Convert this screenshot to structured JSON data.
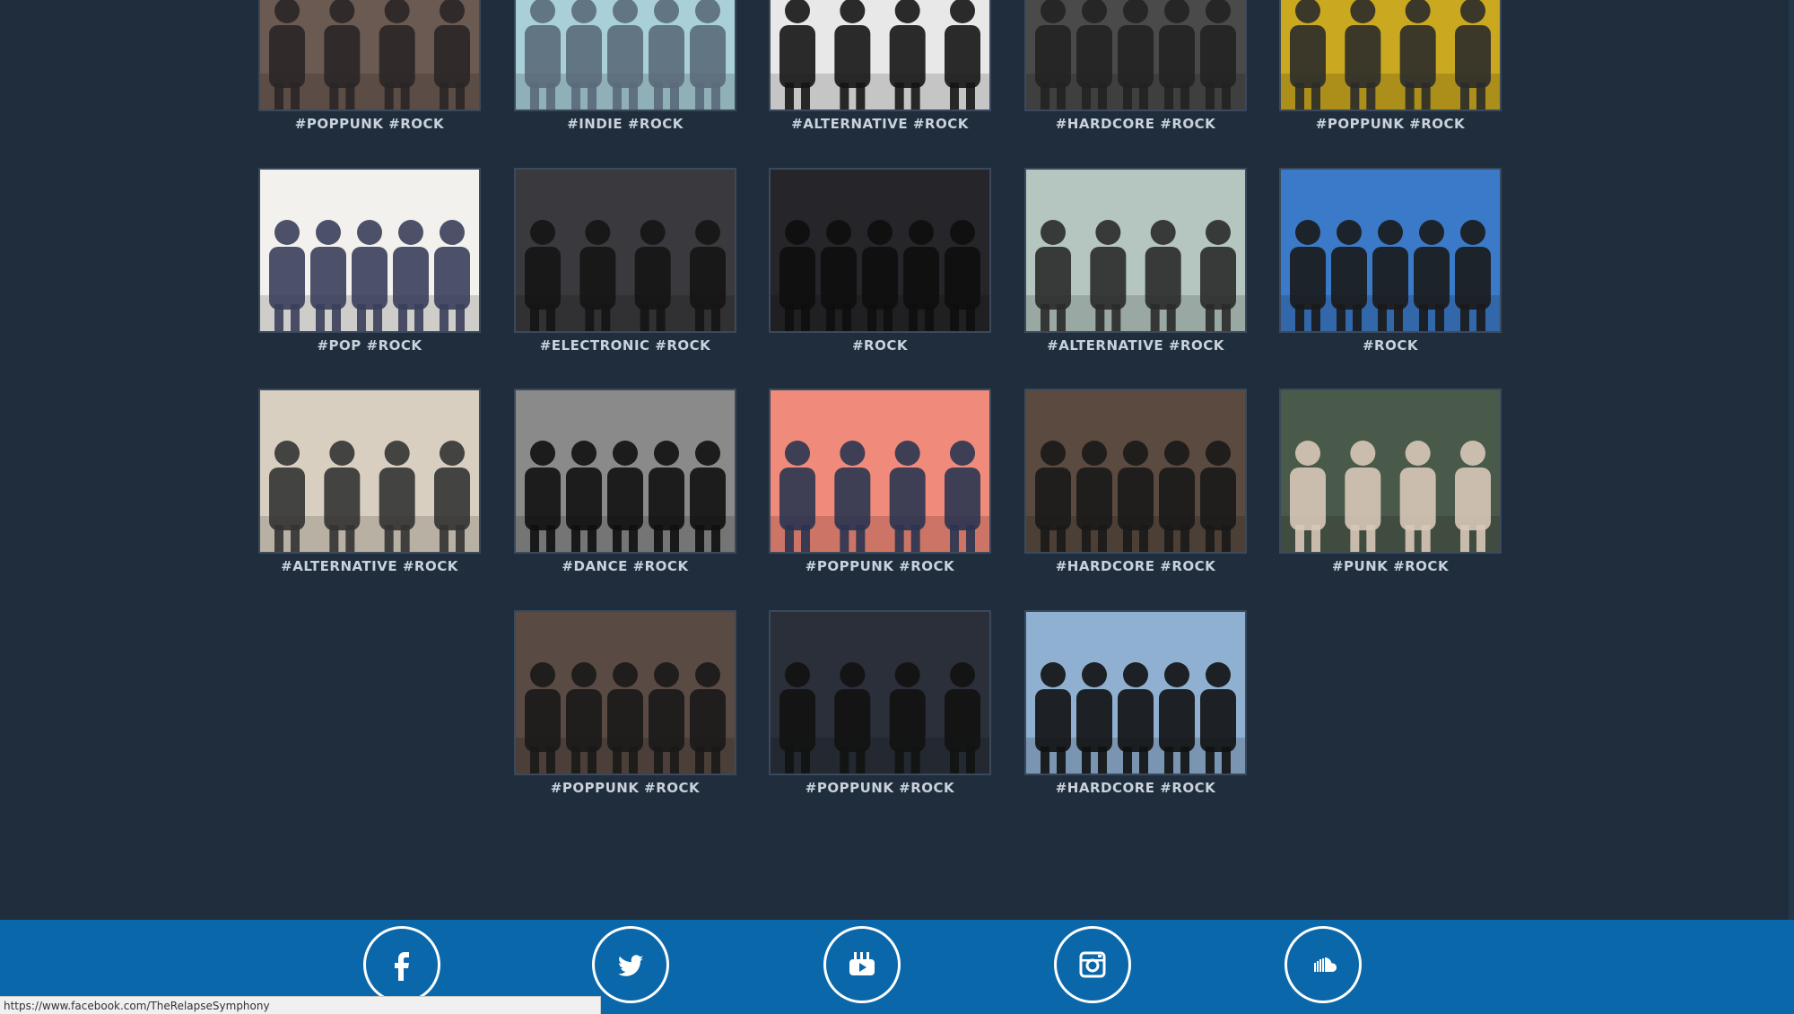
{
  "bands": [
    {
      "tag": "#POPPUNK #ROCK",
      "bg": "#6b5a52",
      "fg": "#2a2626"
    },
    {
      "tag": "#INDIE #ROCK",
      "bg": "#a9cfd8",
      "fg": "#5a6a7a"
    },
    {
      "tag": "#ALTERNATIVE #ROCK",
      "bg": "#e8e8e8",
      "fg": "#151515"
    },
    {
      "tag": "#HARDCORE #ROCK",
      "bg": "#4a4a4a",
      "fg": "#222222"
    },
    {
      "tag": "#POPPUNK #ROCK",
      "bg": "#caa920",
      "fg": "#2b2b2b"
    },
    {
      "tag": "#POP #ROCK",
      "bg": "#f3f1ee",
      "fg": "#3a3f5a"
    },
    {
      "tag": "#ELECTRONIC #ROCK",
      "bg": "#3a3a3e",
      "fg": "#151515"
    },
    {
      "tag": "#ROCK",
      "bg": "#26262a",
      "fg": "#0e0e0e"
    },
    {
      "tag": "#ALTERNATIVE #ROCK",
      "bg": "#b5c6c0",
      "fg": "#2a2a2a"
    },
    {
      "tag": "#ROCK",
      "bg": "#3b7ac8",
      "fg": "#1a1a1a"
    },
    {
      "tag": "#ALTERNATIVE #ROCK",
      "bg": "#d8cfc0",
      "fg": "#333333"
    },
    {
      "tag": "#DANCE #ROCK",
      "bg": "#8a8a8a",
      "fg": "#101010"
    },
    {
      "tag": "#POPPUNK #ROCK",
      "bg": "#f08a7a",
      "fg": "#2a3550"
    },
    {
      "tag": "#HARDCORE #ROCK",
      "bg": "#5a4a40",
      "fg": "#1a1a1a"
    },
    {
      "tag": "#PUNK #ROCK",
      "bg": "#4a5a4a",
      "fg": "#d8c8b8"
    },
    {
      "tag": "#POPPUNK #ROCK",
      "bg": "#5a4a44",
      "fg": "#1a1a1a"
    },
    {
      "tag": "#POPPUNK #ROCK",
      "bg": "#2a2f3a",
      "fg": "#121212"
    },
    {
      "tag": "#HARDCORE #ROCK",
      "bg": "#8fb0d0",
      "fg": "#111111"
    }
  ],
  "footer": {
    "bg": "#0a68aa",
    "icons": [
      "facebook-icon",
      "twitter-icon",
      "youtube-icon",
      "instagram-icon",
      "soundcloud-icon"
    ]
  },
  "status": {
    "url": "https://www.facebook.com/TheRelapseSymphony"
  }
}
